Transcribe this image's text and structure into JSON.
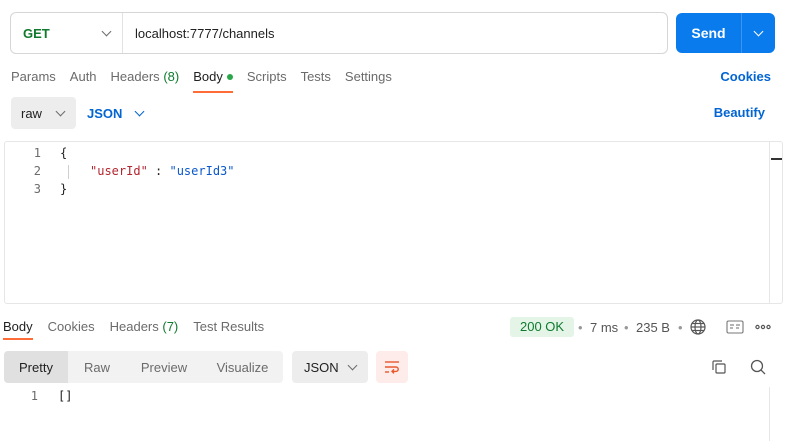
{
  "request": {
    "method": "GET",
    "url": "localhost:7777/channels",
    "send_label": "Send"
  },
  "tabs": {
    "params": "Params",
    "auth": "Auth",
    "headers": "Headers",
    "headers_count": "(8)",
    "body": "Body",
    "scripts": "Scripts",
    "tests": "Tests",
    "settings": "Settings",
    "cookies": "Cookies"
  },
  "body_options": {
    "raw": "raw",
    "json": "JSON",
    "beautify": "Beautify"
  },
  "editor": {
    "lines": [
      {
        "num": "1",
        "text": "{"
      },
      {
        "num": "2",
        "key": "\"userId\"",
        "sep": " : ",
        "value": "\"userId3\""
      },
      {
        "num": "3",
        "text": "}"
      }
    ]
  },
  "response": {
    "tabs": {
      "body": "Body",
      "cookies": "Cookies",
      "headers": "Headers",
      "headers_count": "(7)",
      "test_results": "Test Results"
    },
    "status": "200 OK",
    "time": "7 ms",
    "size": "235 B",
    "formats": [
      "Pretty",
      "Raw",
      "Preview",
      "Visualize"
    ],
    "language": "JSON",
    "lines": [
      {
        "num": "1",
        "text": "[]"
      }
    ]
  },
  "colors": {
    "accent": "#ff6c37",
    "send": "#097bed",
    "link": "#0265d2",
    "method": "#0f7a2e",
    "status_bg": "#e4f5e8"
  }
}
